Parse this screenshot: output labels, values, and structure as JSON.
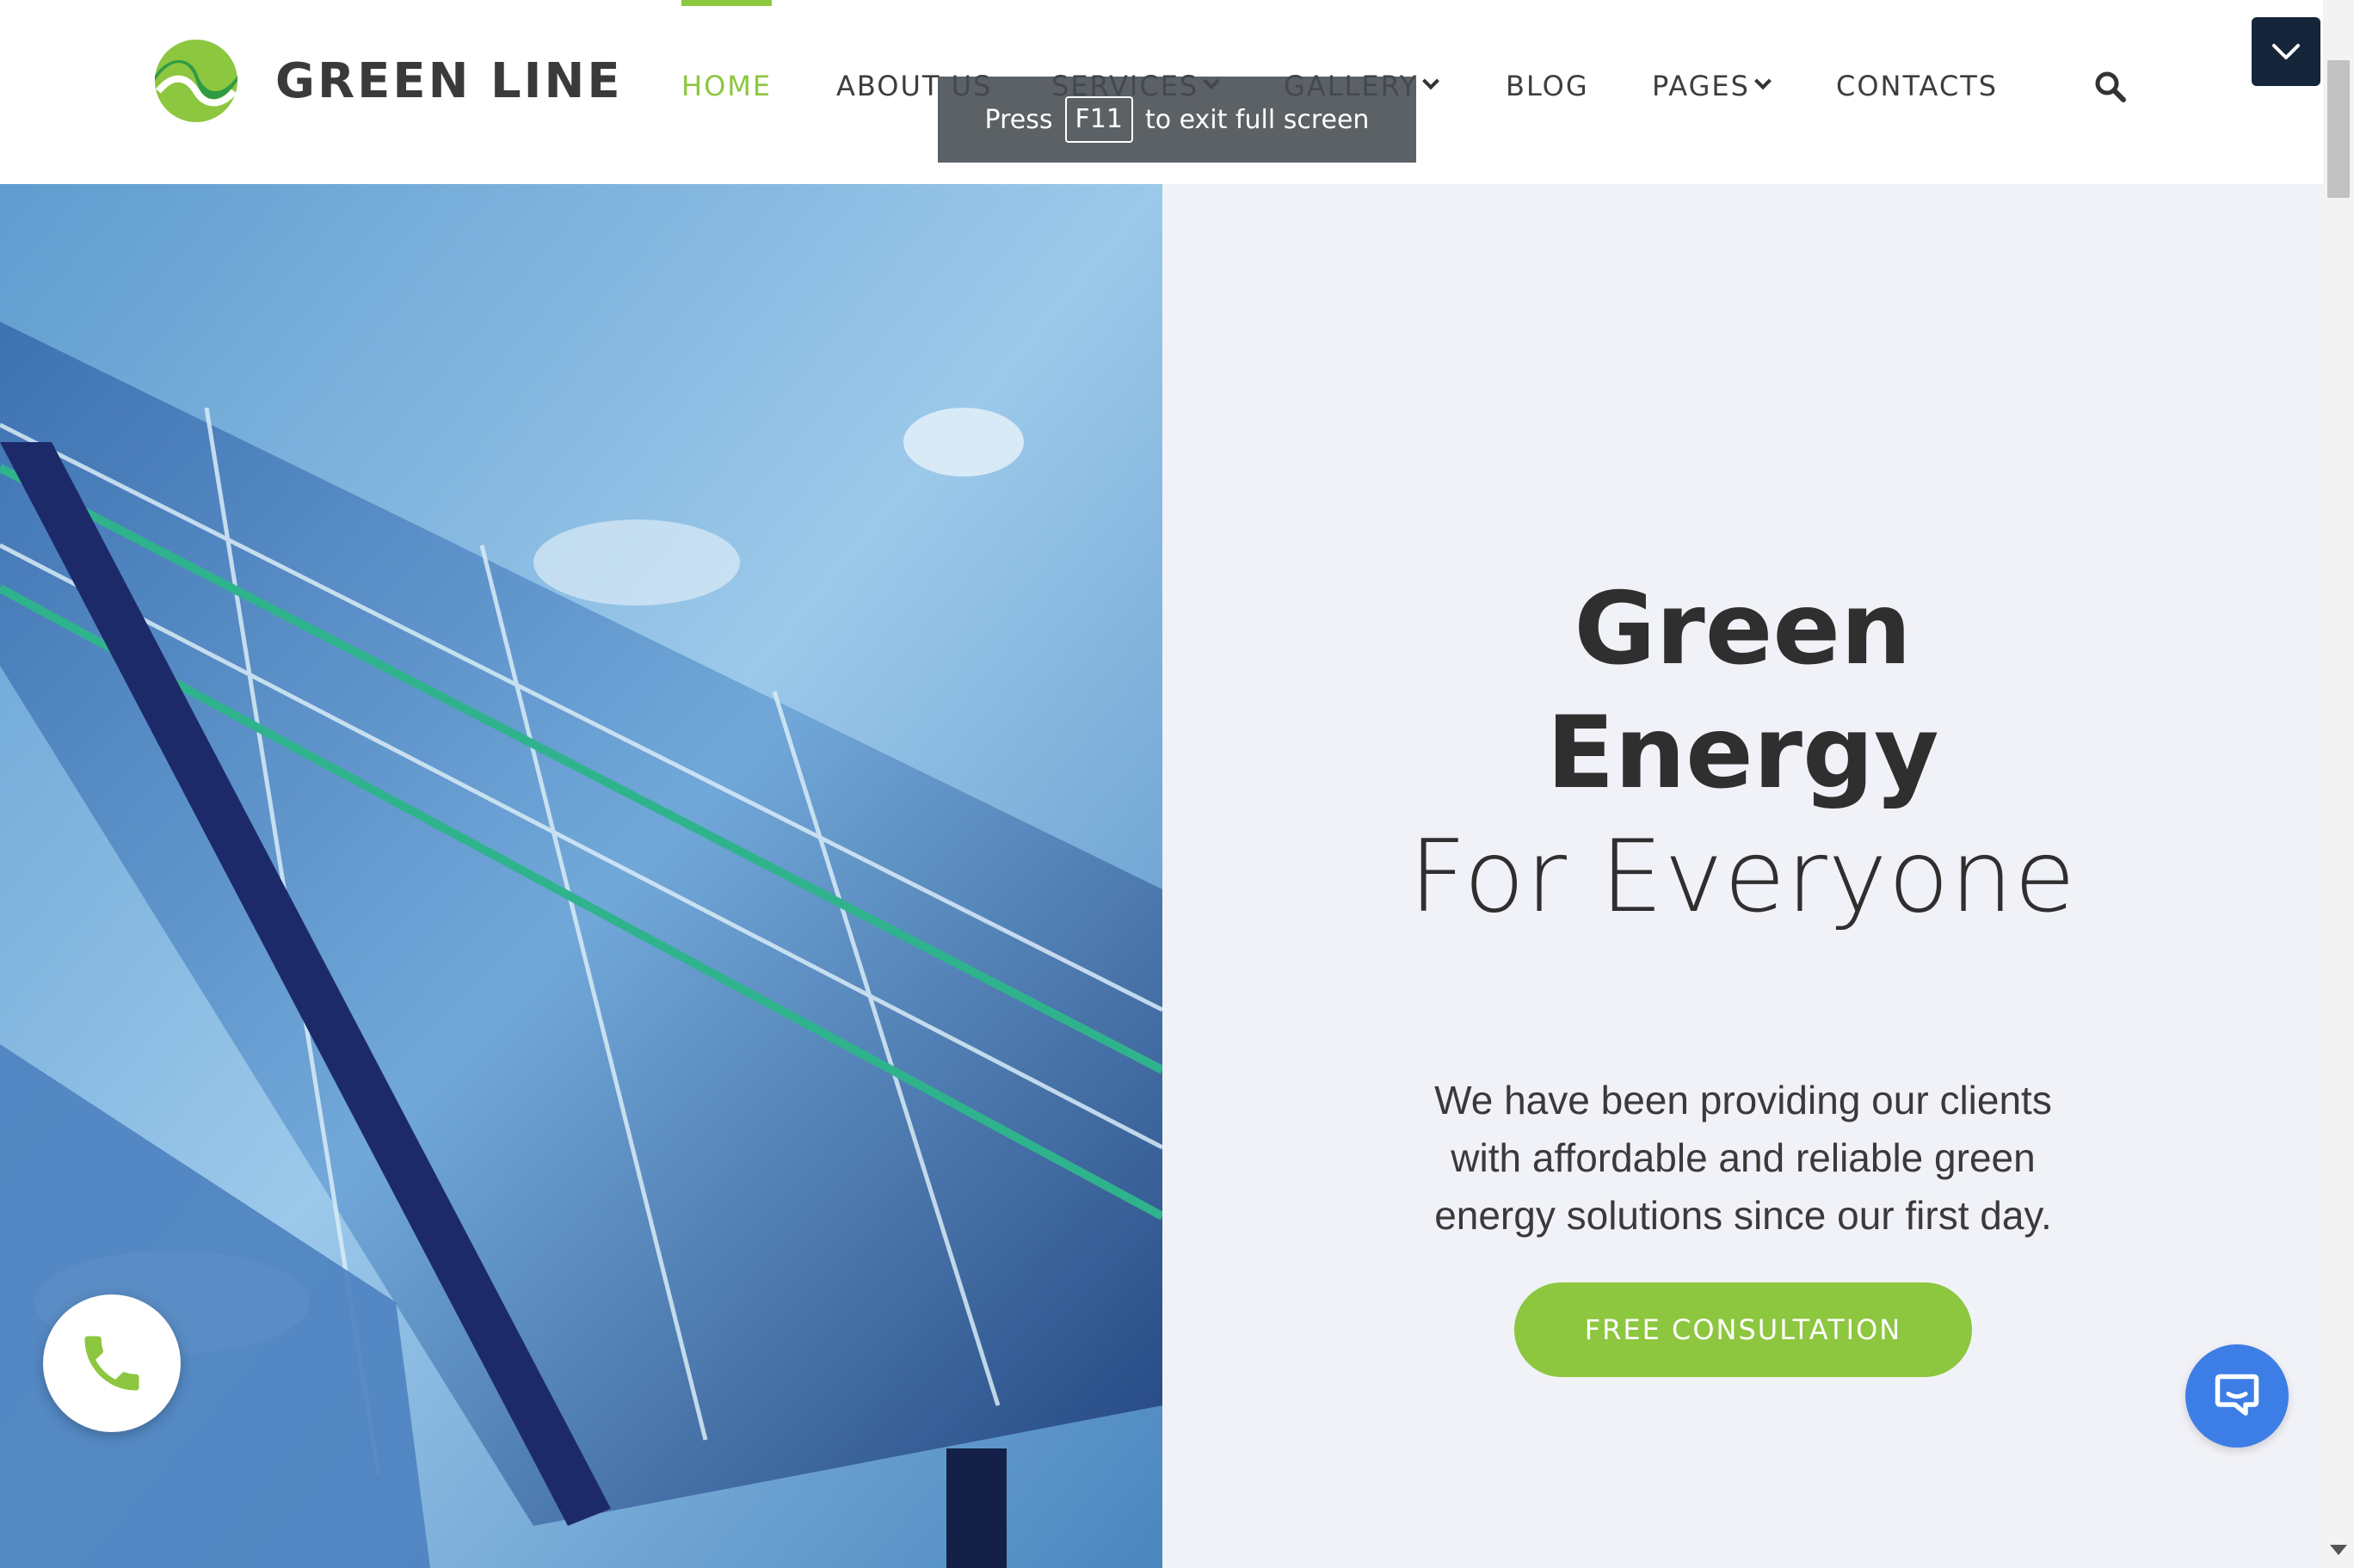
{
  "brand": {
    "name": "GREEN LINE",
    "logo_icon": "green-wave-logo-icon",
    "accent_color": "#8dc63f",
    "dark_color": "#16263a"
  },
  "nav": {
    "home": "HOME",
    "about": "ABOUT US",
    "services": "SERVICES",
    "gallery": "GALLERY",
    "blog": "BLOG",
    "pages": "PAGES",
    "contacts": "CONTACTS",
    "active": "HOME",
    "search_icon": "search-icon"
  },
  "fullscreen_toast": {
    "before": "Press",
    "key": "F11",
    "after": "to exit full screen"
  },
  "hero": {
    "title_line1": "Green",
    "title_line2": "Energy",
    "title_line3": "For Everyone",
    "description": "We have been providing our clients with affordable and reliable green energy solutions since our first day.",
    "cta_label": "FREE CONSULTATION",
    "image": "solar-panels-under-sky-image"
  },
  "widgets": {
    "phone_icon": "phone-icon",
    "chat_icon": "chat-icon",
    "collapse_icon": "chevron-down-icon"
  }
}
